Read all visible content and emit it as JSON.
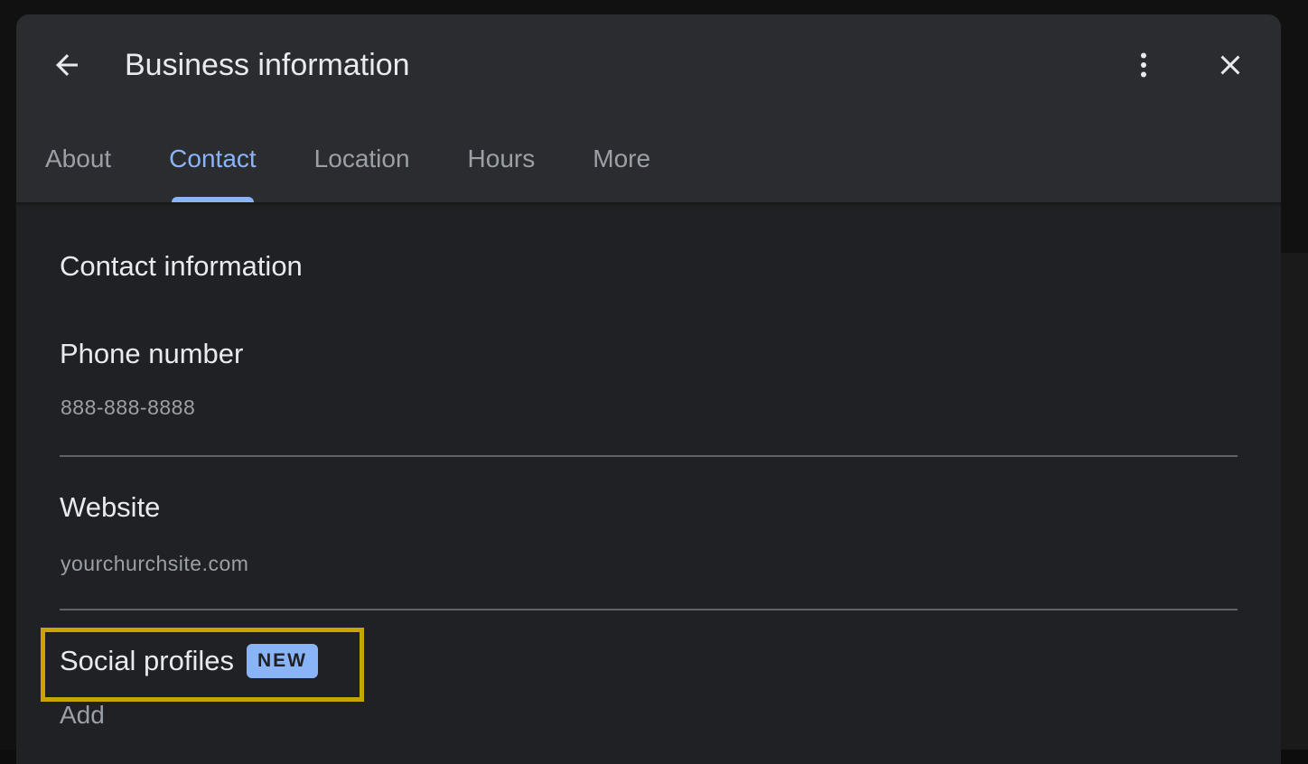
{
  "header": {
    "title": "Business information",
    "back_icon": "arrow-left-icon",
    "more_icon": "more-vert-icon",
    "close_icon": "close-icon"
  },
  "tabs": [
    {
      "label": "About",
      "active": false
    },
    {
      "label": "Contact",
      "active": true
    },
    {
      "label": "Location",
      "active": false
    },
    {
      "label": "Hours",
      "active": false
    },
    {
      "label": "More",
      "active": false
    }
  ],
  "contact": {
    "section_title": "Contact information",
    "phone": {
      "label": "Phone number",
      "value": "888-888-8888"
    },
    "website": {
      "label": "Website",
      "value": "yourchurchsite.com"
    },
    "social": {
      "label": "Social profiles",
      "badge": "NEW",
      "action": "Add"
    }
  },
  "colors": {
    "accent": "#8ab4f8",
    "highlight": "#c9a500",
    "surface": "#202124",
    "header": "#2b2c2f"
  }
}
